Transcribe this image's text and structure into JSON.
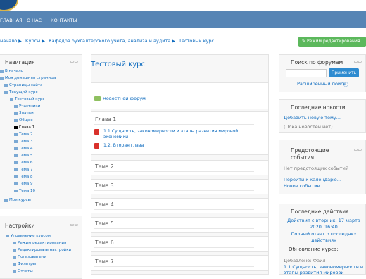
{
  "navbar": {
    "items": [
      "ГЛАВНАЯ",
      "О НАС",
      "КОНТАКТЫ"
    ]
  },
  "breadcrumb": [
    "начало",
    "Курсы",
    "Кафедра бухгалтерского учёта, анализа и аудита",
    "Тестовый курс"
  ],
  "edit_button": "Режим редактирования",
  "navigation": {
    "title": "Навигация",
    "items": [
      "В начало",
      "Моя домашняя страница",
      "Страницы сайта",
      "Текущий курс",
      "Тестовый курс",
      "Участники",
      "Значки",
      "Общее",
      "Глава 1",
      "Тема 2",
      "Тема 3",
      "Тема 4",
      "Тема 5",
      "Тема 6",
      "Тема 7",
      "Тема 8",
      "Тема 9",
      "Тема 10",
      "Мои курсы"
    ]
  },
  "settings": {
    "title": "Настройки",
    "items": [
      "Управление курсом",
      "Режим редактирования",
      "Редактировать настройки",
      "Пользователи",
      "Фильтры",
      "Отчеты"
    ]
  },
  "course": {
    "title": "Тестовый курс",
    "forum": "Новостной форум",
    "chapter": "Глава 1",
    "resources": [
      "1.1 Сущность, закономерности и этапы развития мировой экономики",
      "1.2. Вторая глава"
    ],
    "topics": [
      "Тема 2",
      "Тема 3",
      "Тема 4",
      "Тема 5",
      "Тема 6",
      "Тема 7"
    ]
  },
  "forum_search": {
    "title": "Поиск по форумам",
    "button": "Применить",
    "advanced": "Расширенный поиск"
  },
  "news": {
    "title": "Последние новости",
    "add": "Добавить новую тему...",
    "empty": "(Пока новостей нет)"
  },
  "events": {
    "title_line1": "Предстоящие",
    "title_line2": "события",
    "empty": "Нет предстоящих событий",
    "calendar": "Перейти к календарю...",
    "new": "Новое событие..."
  },
  "activity": {
    "title": "Последние действия",
    "since": "Действия с вторник, 17 марта 2020, 16:40",
    "full_report": "Полный отчет о последних действиях",
    "updates": "Обновление курса:",
    "added": "Добавлено: Файл",
    "file": "1.1 Сущность, закономерности и этапы развития мировой"
  }
}
